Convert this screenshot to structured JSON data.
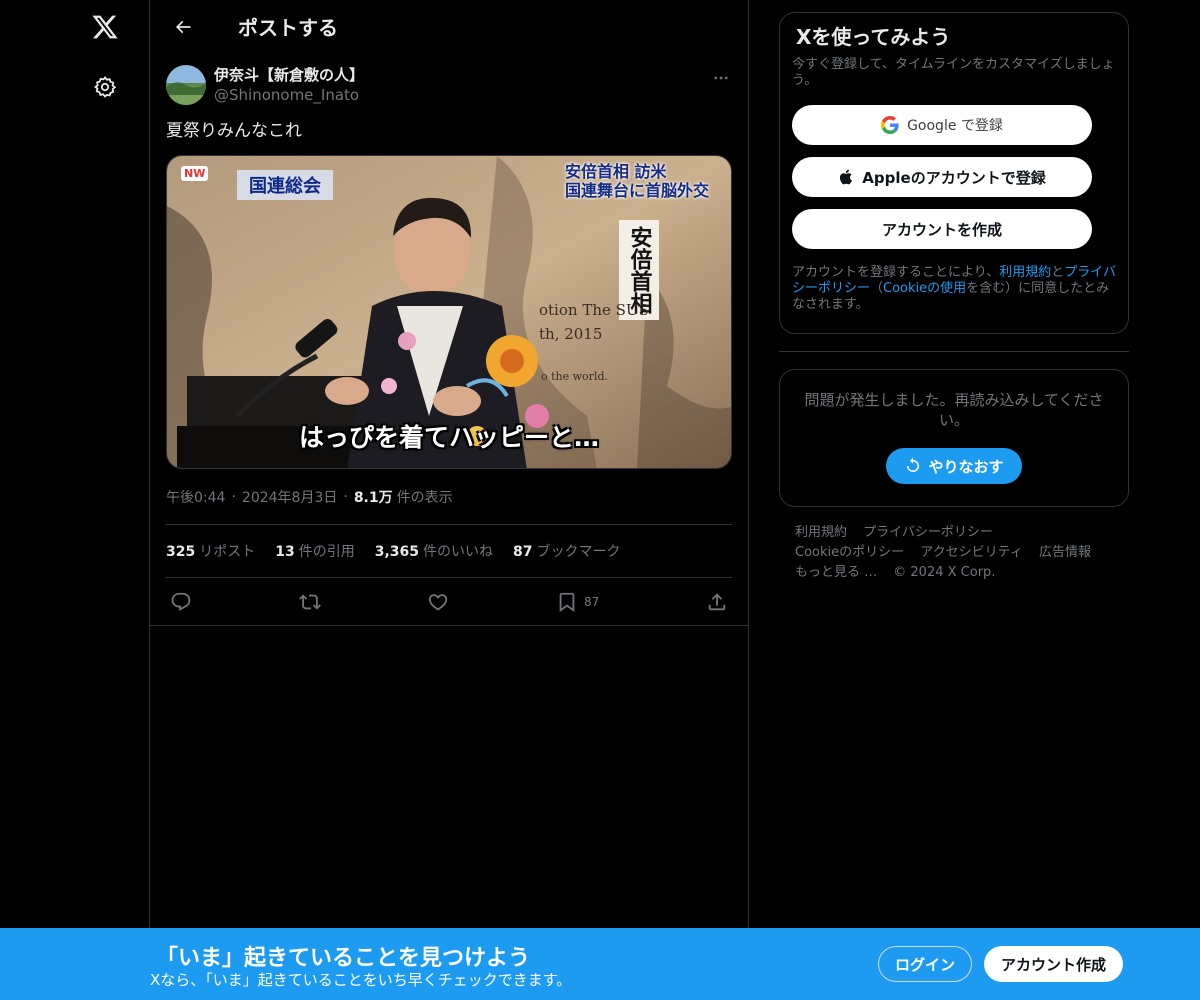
{
  "nav": {
    "logo_icon": "x-logo-icon",
    "settings_icon": "gear-icon"
  },
  "header": {
    "title": "ポストする"
  },
  "post": {
    "author_name": "伊奈斗【新倉敷の人】",
    "author_handle": "@Shinonome_Inato",
    "text": "夏祭りみんなこれ",
    "media": {
      "badge": "国連総会",
      "logo": "NW",
      "headline_line1": "安倍首相 訪米",
      "headline_line2": "国連舞台に首脳外交",
      "vertical_caption": "安倍首相",
      "bg_text_line1": "otion The SUS",
      "bg_text_line2": "th, 2015",
      "bg_text_line3": "o the world.",
      "caption": "はっぴを着てハッピーと…"
    },
    "time": "午後0:44",
    "date": "2024年8月3日",
    "views_count": "8.1万",
    "views_label": "件の表示",
    "stats": {
      "reposts_count": "325",
      "reposts_label": "リポスト",
      "quotes_count": "13",
      "quotes_label": "件の引用",
      "likes_count": "3,365",
      "likes_label": "件のいいね",
      "bookmarks_count": "87",
      "bookmarks_label": "ブックマーク"
    },
    "actions": {
      "bookmark_count": "87"
    }
  },
  "signup": {
    "title": "Xを使ってみよう",
    "subtitle": "今すぐ登録して、タイムラインをカスタマイズしましょう。",
    "google_label": "Google で登録",
    "apple_label": "Appleのアカウントで登録",
    "create_label": "アカウントを作成",
    "legal_pre": "アカウントを登録することにより、",
    "legal_terms": "利用規約",
    "legal_and": "と",
    "legal_privacy": "プライバシーポリシー",
    "legal_paren_open": "（",
    "legal_cookie": "Cookieの使用",
    "legal_post": "を含む）に同意したとみなされます。"
  },
  "error": {
    "message": "問題が発生しました。再読み込みしてください。",
    "retry_label": "やりなおす"
  },
  "footer": {
    "terms": "利用規約",
    "privacy": "プライバシーポリシー",
    "cookie": "Cookieのポリシー",
    "accessibility": "アクセシビリティ",
    "ads": "広告情報",
    "more": "もっと見る …",
    "copyright": "© 2024 X Corp."
  },
  "banner": {
    "title": "「いま」起きていることを見つけよう",
    "subtitle": "Xなら、「いま」起きていることをいち早くチェックできます。",
    "login_label": "ログイン",
    "signup_label": "アカウント作成"
  },
  "colors": {
    "accent": "#1d9bf0",
    "background": "#000000",
    "border": "#2f3336",
    "muted_text": "#71767b"
  }
}
